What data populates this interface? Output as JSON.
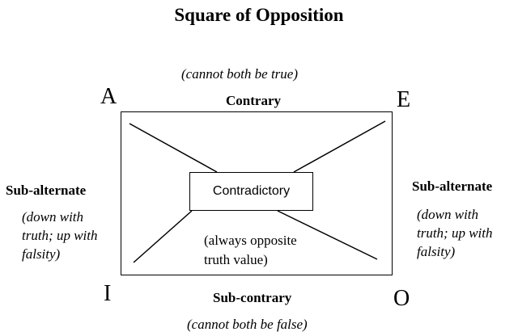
{
  "title": "Square of Opposition",
  "corners": {
    "a": "A",
    "e": "E",
    "i": "I",
    "o": "O"
  },
  "top": {
    "note": "(cannot both be true)",
    "label": "Contrary"
  },
  "bottom": {
    "label": "Sub-contrary",
    "note": "(cannot both be false)"
  },
  "left": {
    "label": "Sub-alternate",
    "note": [
      "(down with",
      "truth; up with",
      "falsity)"
    ]
  },
  "right": {
    "label": "Sub-alternate",
    "note": [
      "(down with",
      "truth; up with",
      "falsity)"
    ]
  },
  "center": {
    "label": "Contradictory",
    "note": [
      "(always opposite",
      "truth value)"
    ]
  },
  "colors": {
    "ink": "#000000",
    "background": "#ffffff"
  }
}
